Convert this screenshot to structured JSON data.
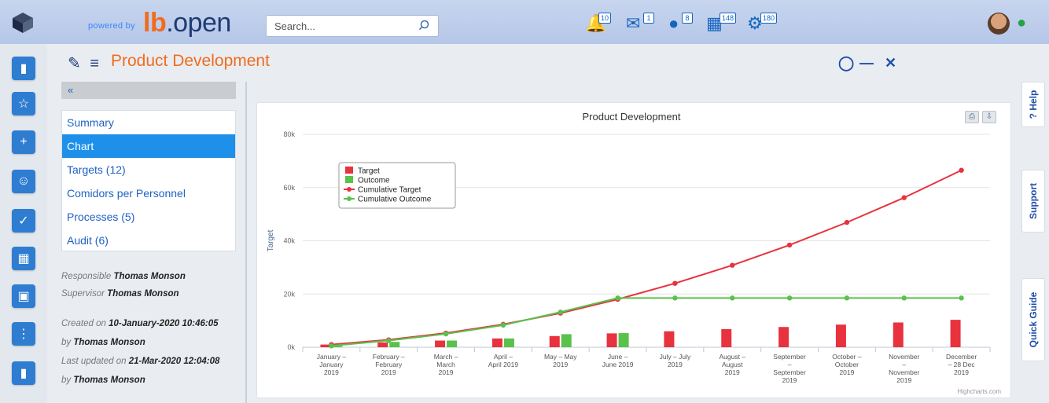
{
  "topbar": {
    "powered_by": "powered by",
    "brand_prefix": "lb",
    "brand_suffix": ".open",
    "search_placeholder": "Search...",
    "notifications": [
      {
        "icon": "bell-icon",
        "count": "10"
      },
      {
        "icon": "mail-icon",
        "count": "1"
      },
      {
        "icon": "chat-bubble-icon",
        "count": "8"
      },
      {
        "icon": "calendar-icon",
        "count": "148"
      },
      {
        "icon": "tasks-gear-icon",
        "count": "180"
      }
    ]
  },
  "leftnav": [
    "folder-icon",
    "star-icon",
    "plus-icon",
    "group-icon",
    "check-icon",
    "grid-icon",
    "apps-icon",
    "dots-grid-icon",
    "report-icon"
  ],
  "page": {
    "title": "Product Development",
    "collapse_label": "«"
  },
  "side_menu": [
    {
      "label": "Summary",
      "active": false
    },
    {
      "label": "Chart",
      "active": true
    },
    {
      "label": "Targets (12)",
      "active": false
    },
    {
      "label": "Comidors per Personnel",
      "active": false
    },
    {
      "label": "Processes (5)",
      "active": false
    },
    {
      "label": "Audit (6)",
      "active": false
    }
  ],
  "meta": {
    "responsible_label": "Responsible",
    "responsible": "Thomas Monson",
    "supervisor_label": "Supervisor",
    "supervisor": "Thomas Monson",
    "created_label": "Created on",
    "created": "10-January-2020 10:46:05",
    "by_label": "by",
    "created_by": "Thomas Monson",
    "updated_label": "Last updated on",
    "updated": "21-Mar-2020 12:04:08",
    "updated_by": "Thomas Monson"
  },
  "right_rail": {
    "help": "? Help",
    "support": "Support",
    "quick_guide": "Quick Guide"
  },
  "colors": {
    "accent": "#f26b1d",
    "primary": "#1e90ea",
    "target": "#e8323d",
    "outcome": "#59c24b"
  },
  "chart_data": {
    "type": "bar",
    "title": "Product Development",
    "ylabel": "Target",
    "ylim": [
      0,
      80000
    ],
    "yticks": [
      "0k",
      "20k",
      "40k",
      "60k",
      "80k"
    ],
    "categories": [
      [
        "January –",
        "January",
        "2019"
      ],
      [
        "February –",
        "February",
        "2019"
      ],
      [
        "March –",
        "March",
        "2019"
      ],
      [
        "April –",
        "April 2019"
      ],
      [
        "May – May",
        "2019"
      ],
      [
        "June –",
        "June 2019"
      ],
      [
        "July – July",
        "2019"
      ],
      [
        "August –",
        "August",
        "2019"
      ],
      [
        "September",
        "–",
        "September",
        "2019"
      ],
      [
        "October –",
        "October",
        "2019"
      ],
      [
        "November",
        "–",
        "November",
        "2019"
      ],
      [
        "December",
        "– 28 Dec",
        "2019"
      ]
    ],
    "legend": [
      "Target",
      "Outcome",
      "Cumulative Target",
      "Cumulative Outcome"
    ],
    "series": [
      {
        "name": "Target",
        "kind": "bar",
        "values": [
          1000,
          1800,
          2500,
          3300,
          4200,
          5200,
          6000,
          6800,
          7600,
          8500,
          9300,
          10300
        ]
      },
      {
        "name": "Outcome",
        "kind": "bar",
        "values": [
          500,
          2000,
          2500,
          3300,
          4900,
          5300,
          0,
          0,
          0,
          0,
          0,
          0
        ]
      },
      {
        "name": "Cumulative Target",
        "kind": "line",
        "values": [
          1000,
          2800,
          5300,
          8600,
          12800,
          18000,
          24000,
          30800,
          38400,
          46900,
          56200,
          66500
        ]
      },
      {
        "name": "Cumulative Outcome",
        "kind": "line",
        "values": [
          500,
          2500,
          5000,
          8300,
          13200,
          18500,
          18500,
          18500,
          18500,
          18500,
          18500,
          18500
        ]
      }
    ],
    "credit": "Highcharts.com"
  }
}
